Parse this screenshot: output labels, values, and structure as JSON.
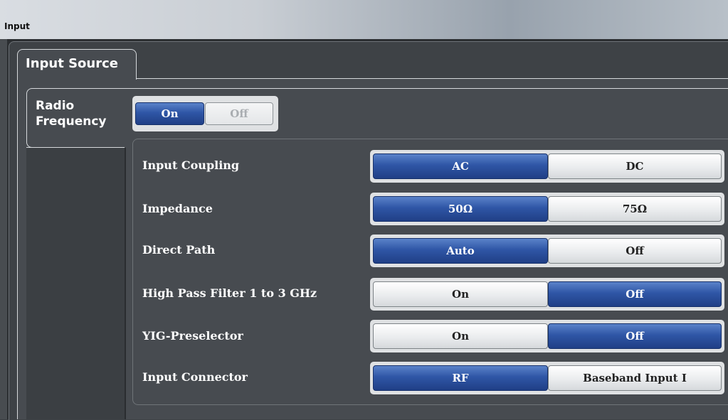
{
  "window": {
    "title": "Input"
  },
  "tab": {
    "label": "Input Source"
  },
  "side_tab": {
    "line1": "Radio",
    "line2": "Frequency"
  },
  "rf_toggle": {
    "on": "On",
    "off": "Off",
    "selected": "On"
  },
  "rows": [
    {
      "label": "Input Coupling",
      "left": "AC",
      "right": "DC",
      "selected": "left"
    },
    {
      "label": "Impedance",
      "left": "50Ω",
      "right": "75Ω",
      "selected": "left"
    },
    {
      "label": "Direct Path",
      "left": "Auto",
      "right": "Off",
      "selected": "left"
    },
    {
      "label": "High Pass Filter 1 to 3 GHz",
      "left": "On",
      "right": "Off",
      "selected": "right"
    },
    {
      "label": "YIG-Preselector",
      "left": "On",
      "right": "Off",
      "selected": "right"
    },
    {
      "label": "Input Connector",
      "left": "RF",
      "right": "Baseband Input I",
      "selected": "left"
    }
  ],
  "colors": {
    "selected": "#2f56a6",
    "unselected": "#e8eaec",
    "panel": "#474b50"
  }
}
